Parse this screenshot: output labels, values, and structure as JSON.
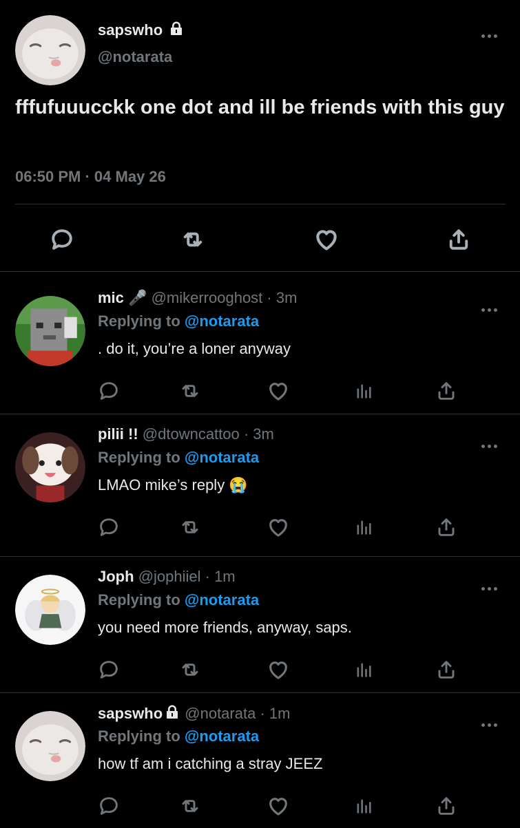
{
  "main_tweet": {
    "display_name": "sapswho",
    "handle": "@notarata",
    "text": "fffufuuucckk one dot  and ill be friends with this guy",
    "timestamp": "06:50 PM · 04 May 26",
    "avatar_icon": "cat-avatar",
    "lock_icon": "lock-icon"
  },
  "replies": [
    {
      "display_name": "mic",
      "name_emoji": "🎤",
      "meta": "@mikerrooghost · 3m",
      "replying_prefix": "Replying to ",
      "replying_handle": "@notarata",
      "text": ". do it, you’re a loner anyway",
      "avatar_icon": "minecraft-avatar"
    },
    {
      "display_name": "pilii !!",
      "name_emoji": "",
      "meta": "@dtowncattoo · 3m",
      "replying_prefix": "Replying to ",
      "replying_handle": "@notarata",
      "text": "LMAO mike’s reply 😭",
      "avatar_icon": "cartoon-dog-avatar"
    },
    {
      "display_name": "Joph",
      "name_emoji": "",
      "meta": "@jophiiel · 1m",
      "replying_prefix": "Replying to ",
      "replying_handle": "@notarata",
      "text": "you need more friends, anyway, saps.",
      "avatar_icon": "angel-drawing-avatar"
    },
    {
      "display_name": "sapswho",
      "name_emoji": "",
      "meta": "@notarata · 1m",
      "replying_prefix": "Replying to ",
      "replying_handle": "@notarata",
      "text": "how tf am i catching a stray JEEZ",
      "avatar_icon": "cat-avatar"
    }
  ],
  "colors": {
    "background": "#000000",
    "text": "#e7e9ea",
    "muted": "#71767b",
    "link": "#1d9bf0",
    "divider": "#2f3336"
  }
}
